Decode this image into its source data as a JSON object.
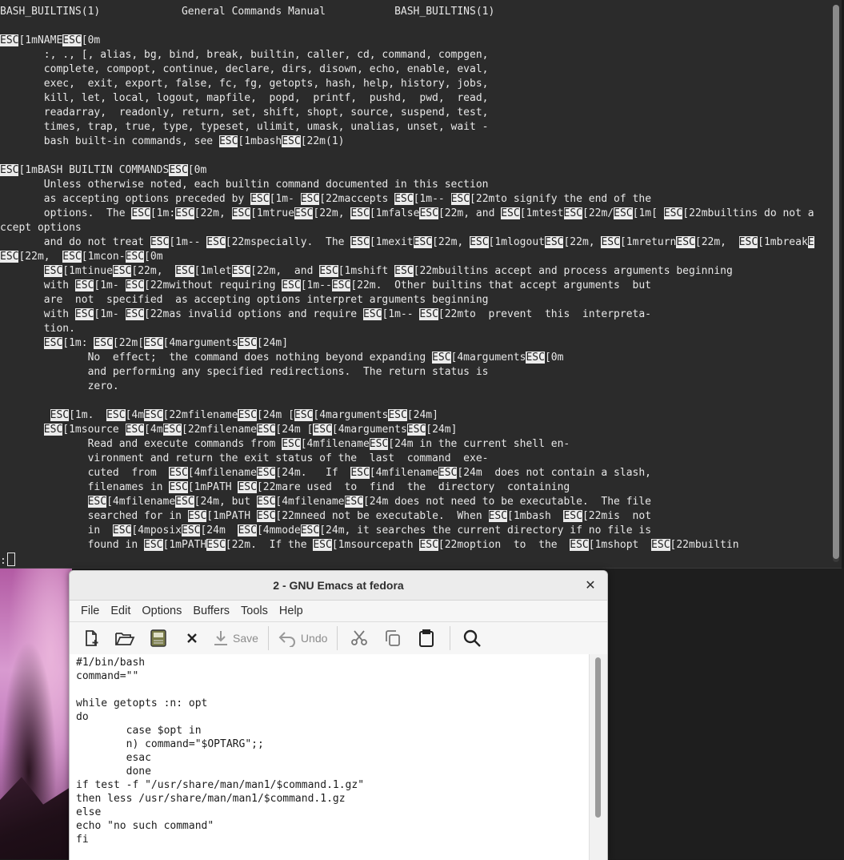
{
  "terminal": {
    "lines": [
      [
        {
          "t": "BASH_BUILTINS(1)             General Commands Manual           BASH_BUILTINS(1)"
        }
      ],
      [
        {
          "t": ""
        }
      ],
      [
        {
          "t": "ESC",
          "e": 1
        },
        {
          "t": "[1mNAME"
        },
        {
          "t": "ESC",
          "e": 1
        },
        {
          "t": "[0m"
        }
      ],
      [
        {
          "t": "       :, ., [, alias, bg, bind, break, builtin, caller, cd, command, compgen,"
        }
      ],
      [
        {
          "t": "       complete, compopt, continue, declare, dirs, disown, echo, enable, eval,"
        }
      ],
      [
        {
          "t": "       exec,  exit, export, false, fc, fg, getopts, hash, help, history, jobs,"
        }
      ],
      [
        {
          "t": "       kill, let, local, logout, mapfile,  popd,  printf,  pushd,  pwd,  read,"
        }
      ],
      [
        {
          "t": "       readarray,  readonly, return, set, shift, shopt, source, suspend, test,"
        }
      ],
      [
        {
          "t": "       times, trap, true, type, typeset, ulimit, umask, unalias, unset, wait -"
        }
      ],
      [
        {
          "t": "       bash built-in commands, see "
        },
        {
          "t": "ESC",
          "e": 1
        },
        {
          "t": "[1mbash"
        },
        {
          "t": "ESC",
          "e": 1
        },
        {
          "t": "[22m(1)"
        }
      ],
      [
        {
          "t": ""
        }
      ],
      [
        {
          "t": "ESC",
          "e": 1
        },
        {
          "t": "[1mBASH BUILTIN COMMANDS"
        },
        {
          "t": "ESC",
          "e": 1
        },
        {
          "t": "[0m"
        }
      ],
      [
        {
          "t": "       Unless otherwise noted, each builtin command documented in this section"
        }
      ],
      [
        {
          "t": "       as accepting options preceded by "
        },
        {
          "t": "ESC",
          "e": 1
        },
        {
          "t": "[1m- "
        },
        {
          "t": "ESC",
          "e": 1
        },
        {
          "t": "[22maccepts "
        },
        {
          "t": "ESC",
          "e": 1
        },
        {
          "t": "[1m-- "
        },
        {
          "t": "ESC",
          "e": 1
        },
        {
          "t": "[22mto signify the end of the"
        }
      ],
      [
        {
          "t": "       options.  The "
        },
        {
          "t": "ESC",
          "e": 1
        },
        {
          "t": "[1m:"
        },
        {
          "t": "ESC",
          "e": 1
        },
        {
          "t": "[22m, "
        },
        {
          "t": "ESC",
          "e": 1
        },
        {
          "t": "[1mtrue"
        },
        {
          "t": "ESC",
          "e": 1
        },
        {
          "t": "[22m, "
        },
        {
          "t": "ESC",
          "e": 1
        },
        {
          "t": "[1mfalse"
        },
        {
          "t": "ESC",
          "e": 1
        },
        {
          "t": "[22m, and "
        },
        {
          "t": "ESC",
          "e": 1
        },
        {
          "t": "[1mtest"
        },
        {
          "t": "ESC",
          "e": 1
        },
        {
          "t": "[22m/"
        },
        {
          "t": "ESC",
          "e": 1
        },
        {
          "t": "[1m[ "
        },
        {
          "t": "ESC",
          "e": 1
        },
        {
          "t": "[22mbuiltins do not a"
        }
      ],
      [
        {
          "t": "ccept options"
        }
      ],
      [
        {
          "t": "       and do not treat "
        },
        {
          "t": "ESC",
          "e": 1
        },
        {
          "t": "[1m-- "
        },
        {
          "t": "ESC",
          "e": 1
        },
        {
          "t": "[22mspecially.  The "
        },
        {
          "t": "ESC",
          "e": 1
        },
        {
          "t": "[1mexit"
        },
        {
          "t": "ESC",
          "e": 1
        },
        {
          "t": "[22m, "
        },
        {
          "t": "ESC",
          "e": 1
        },
        {
          "t": "[1mlogout"
        },
        {
          "t": "ESC",
          "e": 1
        },
        {
          "t": "[22m, "
        },
        {
          "t": "ESC",
          "e": 1
        },
        {
          "t": "[1mreturn"
        },
        {
          "t": "ESC",
          "e": 1
        },
        {
          "t": "[22m,  "
        },
        {
          "t": "ESC",
          "e": 1
        },
        {
          "t": "[1mbreak"
        },
        {
          "t": "E",
          "e": 1
        }
      ],
      [
        {
          "t": "ESC",
          "e": 1
        },
        {
          "t": "[22m,  "
        },
        {
          "t": "ESC",
          "e": 1
        },
        {
          "t": "[1mcon-"
        },
        {
          "t": "ESC",
          "e": 1
        },
        {
          "t": "[0m"
        }
      ],
      [
        {
          "t": "       "
        },
        {
          "t": "ESC",
          "e": 1
        },
        {
          "t": "[1mtinue"
        },
        {
          "t": "ESC",
          "e": 1
        },
        {
          "t": "[22m,  "
        },
        {
          "t": "ESC",
          "e": 1
        },
        {
          "t": "[1mlet"
        },
        {
          "t": "ESC",
          "e": 1
        },
        {
          "t": "[22m,  and "
        },
        {
          "t": "ESC",
          "e": 1
        },
        {
          "t": "[1mshift "
        },
        {
          "t": "ESC",
          "e": 1
        },
        {
          "t": "[22mbuiltins accept and process arguments beginning"
        }
      ],
      [
        {
          "t": "       with "
        },
        {
          "t": "ESC",
          "e": 1
        },
        {
          "t": "[1m- "
        },
        {
          "t": "ESC",
          "e": 1
        },
        {
          "t": "[22mwithout requiring "
        },
        {
          "t": "ESC",
          "e": 1
        },
        {
          "t": "[1m--"
        },
        {
          "t": "ESC",
          "e": 1
        },
        {
          "t": "[22m.  Other builtins that accept arguments  but"
        }
      ],
      [
        {
          "t": "       are  not  specified  as accepting options interpret arguments beginning"
        }
      ],
      [
        {
          "t": "       with "
        },
        {
          "t": "ESC",
          "e": 1
        },
        {
          "t": "[1m- "
        },
        {
          "t": "ESC",
          "e": 1
        },
        {
          "t": "[22mas invalid options and require "
        },
        {
          "t": "ESC",
          "e": 1
        },
        {
          "t": "[1m-- "
        },
        {
          "t": "ESC",
          "e": 1
        },
        {
          "t": "[22mto  prevent  this  interpreta-"
        }
      ],
      [
        {
          "t": "       tion."
        }
      ],
      [
        {
          "t": "       "
        },
        {
          "t": "ESC",
          "e": 1
        },
        {
          "t": "[1m: "
        },
        {
          "t": "ESC",
          "e": 1
        },
        {
          "t": "[22m["
        },
        {
          "t": "ESC",
          "e": 1
        },
        {
          "t": "[4marguments"
        },
        {
          "t": "ESC",
          "e": 1
        },
        {
          "t": "[24m]"
        }
      ],
      [
        {
          "t": "              No  effect;  the command does nothing beyond expanding "
        },
        {
          "t": "ESC",
          "e": 1
        },
        {
          "t": "[4marguments"
        },
        {
          "t": "ESC",
          "e": 1
        },
        {
          "t": "[0m"
        }
      ],
      [
        {
          "t": "              and performing any specified redirections.  The return status is"
        }
      ],
      [
        {
          "t": "              zero."
        }
      ],
      [
        {
          "t": ""
        }
      ],
      [
        {
          "t": "        "
        },
        {
          "t": "ESC",
          "e": 1
        },
        {
          "t": "[1m.  "
        },
        {
          "t": "ESC",
          "e": 1
        },
        {
          "t": "[4m"
        },
        {
          "t": "ESC",
          "e": 1
        },
        {
          "t": "[22mfilename"
        },
        {
          "t": "ESC",
          "e": 1
        },
        {
          "t": "[24m ["
        },
        {
          "t": "ESC",
          "e": 1
        },
        {
          "t": "[4marguments"
        },
        {
          "t": "ESC",
          "e": 1
        },
        {
          "t": "[24m]"
        }
      ],
      [
        {
          "t": "       "
        },
        {
          "t": "ESC",
          "e": 1
        },
        {
          "t": "[1msource "
        },
        {
          "t": "ESC",
          "e": 1
        },
        {
          "t": "[4m"
        },
        {
          "t": "ESC",
          "e": 1
        },
        {
          "t": "[22mfilename"
        },
        {
          "t": "ESC",
          "e": 1
        },
        {
          "t": "[24m ["
        },
        {
          "t": "ESC",
          "e": 1
        },
        {
          "t": "[4marguments"
        },
        {
          "t": "ESC",
          "e": 1
        },
        {
          "t": "[24m]"
        }
      ],
      [
        {
          "t": "              Read and execute commands from "
        },
        {
          "t": "ESC",
          "e": 1
        },
        {
          "t": "[4mfilename"
        },
        {
          "t": "ESC",
          "e": 1
        },
        {
          "t": "[24m in the current shell en-"
        }
      ],
      [
        {
          "t": "              vironment and return the exit status of the  last  command  exe-"
        }
      ],
      [
        {
          "t": "              cuted  from  "
        },
        {
          "t": "ESC",
          "e": 1
        },
        {
          "t": "[4mfilename"
        },
        {
          "t": "ESC",
          "e": 1
        },
        {
          "t": "[24m.   If  "
        },
        {
          "t": "ESC",
          "e": 1
        },
        {
          "t": "[4mfilename"
        },
        {
          "t": "ESC",
          "e": 1
        },
        {
          "t": "[24m  does not contain a slash,"
        }
      ],
      [
        {
          "t": "              filenames in "
        },
        {
          "t": "ESC",
          "e": 1
        },
        {
          "t": "[1mPATH "
        },
        {
          "t": "ESC",
          "e": 1
        },
        {
          "t": "[22mare used  to  find  the  directory  containing"
        }
      ],
      [
        {
          "t": "              "
        },
        {
          "t": "ESC",
          "e": 1
        },
        {
          "t": "[4mfilename"
        },
        {
          "t": "ESC",
          "e": 1
        },
        {
          "t": "[24m, but "
        },
        {
          "t": "ESC",
          "e": 1
        },
        {
          "t": "[4mfilename"
        },
        {
          "t": "ESC",
          "e": 1
        },
        {
          "t": "[24m does not need to be executable.  The file"
        }
      ],
      [
        {
          "t": "              searched for in "
        },
        {
          "t": "ESC",
          "e": 1
        },
        {
          "t": "[1mPATH "
        },
        {
          "t": "ESC",
          "e": 1
        },
        {
          "t": "[22mneed not be executable.  When "
        },
        {
          "t": "ESC",
          "e": 1
        },
        {
          "t": "[1mbash  "
        },
        {
          "t": "ESC",
          "e": 1
        },
        {
          "t": "[22mis  not"
        }
      ],
      [
        {
          "t": "              in  "
        },
        {
          "t": "ESC",
          "e": 1
        },
        {
          "t": "[4mposix"
        },
        {
          "t": "ESC",
          "e": 1
        },
        {
          "t": "[24m  "
        },
        {
          "t": "ESC",
          "e": 1
        },
        {
          "t": "[4mmode"
        },
        {
          "t": "ESC",
          "e": 1
        },
        {
          "t": "[24m, it searches the current directory if no file is"
        }
      ],
      [
        {
          "t": "              found in "
        },
        {
          "t": "ESC",
          "e": 1
        },
        {
          "t": "[1mPATH"
        },
        {
          "t": "ESC",
          "e": 1
        },
        {
          "t": "[22m.  If the "
        },
        {
          "t": "ESC",
          "e": 1
        },
        {
          "t": "[1msourcepath "
        },
        {
          "t": "ESC",
          "e": 1
        },
        {
          "t": "[22moption  to  the  "
        },
        {
          "t": "ESC",
          "e": 1
        },
        {
          "t": "[1mshopt  "
        },
        {
          "t": "ESC",
          "e": 1
        },
        {
          "t": "[22mbuiltin"
        }
      ]
    ],
    "prompt": ":"
  },
  "emacs": {
    "title": "2 - GNU Emacs at fedora",
    "close_glyph": "✕",
    "menu": [
      "File",
      "Edit",
      "Options",
      "Buffers",
      "Tools",
      "Help"
    ],
    "toolbar": {
      "save_label": "Save",
      "undo_label": "Undo"
    },
    "icons": [
      "new-file-icon",
      "open-folder-icon",
      "save-disk-icon",
      "close-buffer-icon",
      "save-icon",
      "undo-icon",
      "cut-icon",
      "copy-icon",
      "paste-icon",
      "search-icon"
    ],
    "buffer_lines": [
      "#1/bin/bash",
      "command=\"\"",
      "",
      "while getopts :n: opt",
      "do",
      "        case $opt in",
      "        n) command=\"$OPTARG\";;",
      "        esac",
      "        done",
      "if test -f \"/usr/share/man/man1/$command.1.gz\"",
      "then less /usr/share/man/man1/$command.1.gz",
      "else",
      "echo \"no such command\"",
      "fi"
    ]
  }
}
